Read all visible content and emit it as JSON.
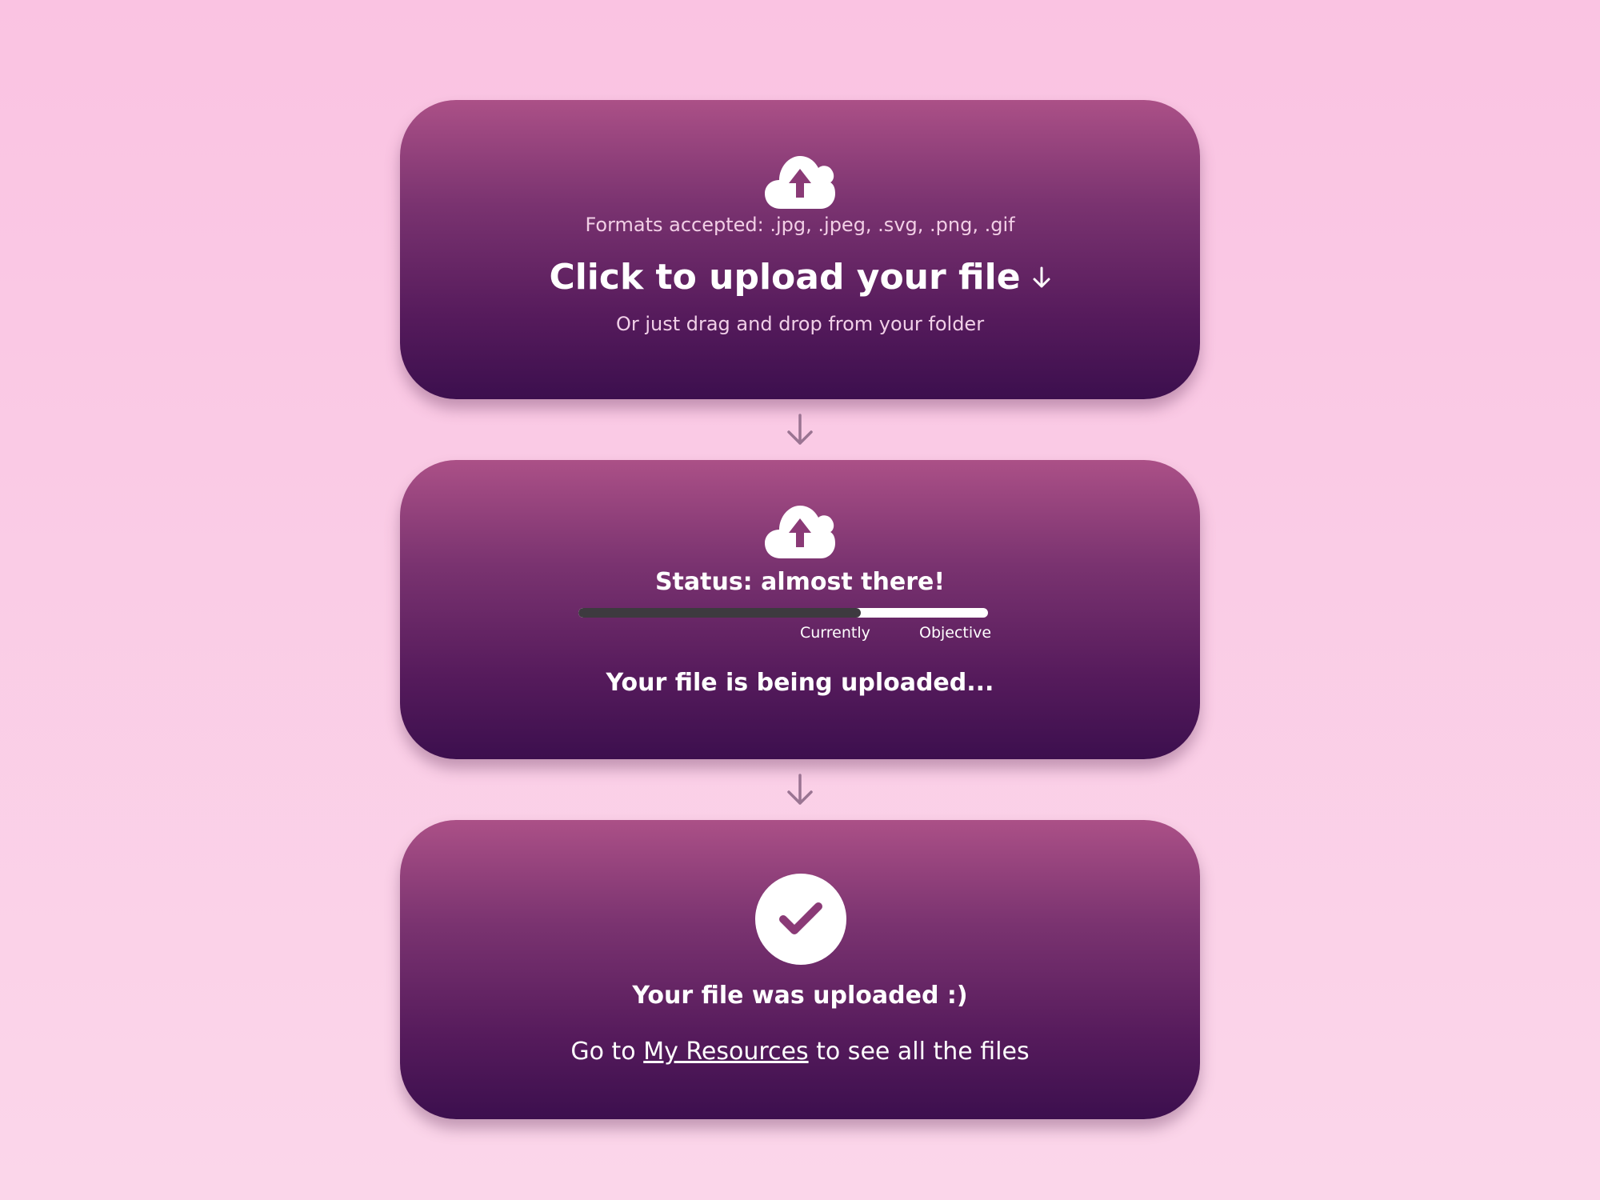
{
  "upload_card": {
    "icon": "cloud-upload-icon",
    "formats_text": "Formats accepted: .jpg, .jpeg, .svg, .png, .gif",
    "cta_label": "Click to upload your file",
    "cta_icon": "arrow-down-icon",
    "drag_hint": "Or just drag and drop from your folder"
  },
  "progress_card": {
    "icon": "cloud-upload-icon",
    "status_text": "Status: almost there!",
    "progress_percent": 69,
    "current_label": "Currently",
    "objective_label": "Objective",
    "uploading_text": "Your file is being uploaded..."
  },
  "done_card": {
    "icon": "checkmark-icon",
    "title": "Your file was uploaded :)",
    "goto_prefix": "Go to",
    "link_label": "My Resources",
    "goto_suffix": "to see all the files"
  },
  "connectors": {
    "icon": "arrow-down-icon"
  },
  "colors": {
    "background": "#fac3e2",
    "card_top": "#ab5087",
    "card_bottom": "#3c0f4e",
    "progress_fill": "#3d3a3f",
    "progress_track": "#ffffff",
    "connector_arrow": "#9a7492"
  }
}
